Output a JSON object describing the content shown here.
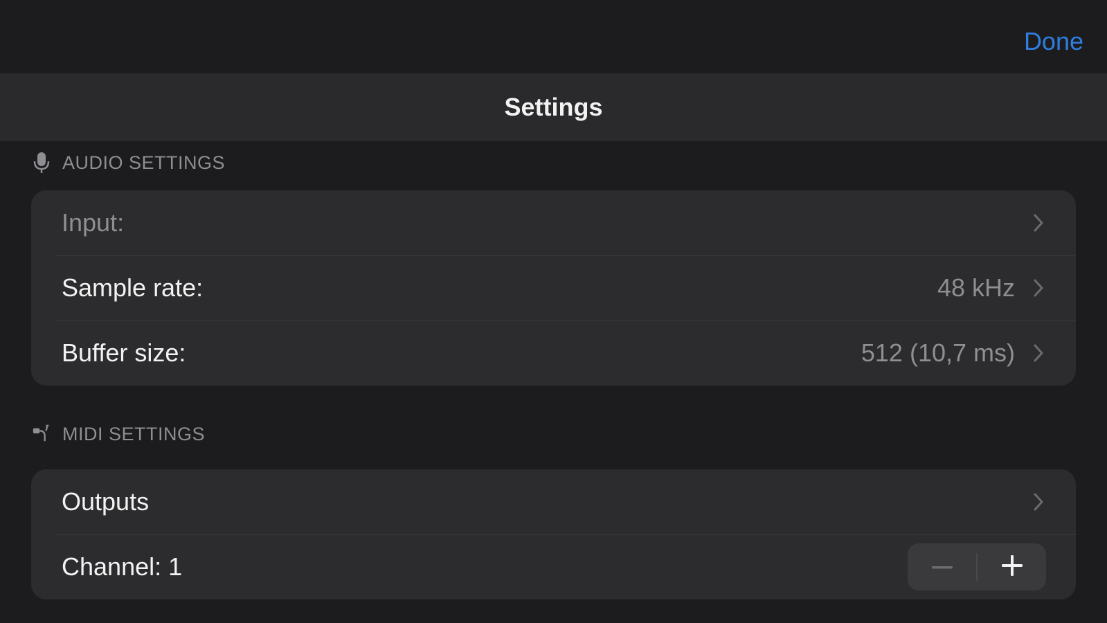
{
  "header": {
    "done_label": "Done",
    "title": "Settings"
  },
  "audio_section": {
    "header_label": "AUDIO SETTINGS",
    "icon": "microphone-icon",
    "rows": [
      {
        "label": "Input:",
        "value": ""
      },
      {
        "label": "Sample rate:",
        "value": "48 kHz"
      },
      {
        "label": "Buffer size:",
        "value": "512 (10,7 ms)"
      }
    ]
  },
  "midi_section": {
    "header_label": "MIDI SETTINGS",
    "icon": "midi-cable-icon",
    "rows": [
      {
        "label": "Outputs"
      },
      {
        "label": "Channel: 1"
      }
    ],
    "stepper": {
      "decrement_icon": "minus-icon",
      "increment_icon": "plus-icon"
    }
  },
  "colors": {
    "background": "#1c1c1e",
    "title_bar": "#2a2a2c",
    "group_background": "#2c2c2e",
    "accent": "#2f7de0",
    "secondary_text": "#8e8e93"
  }
}
